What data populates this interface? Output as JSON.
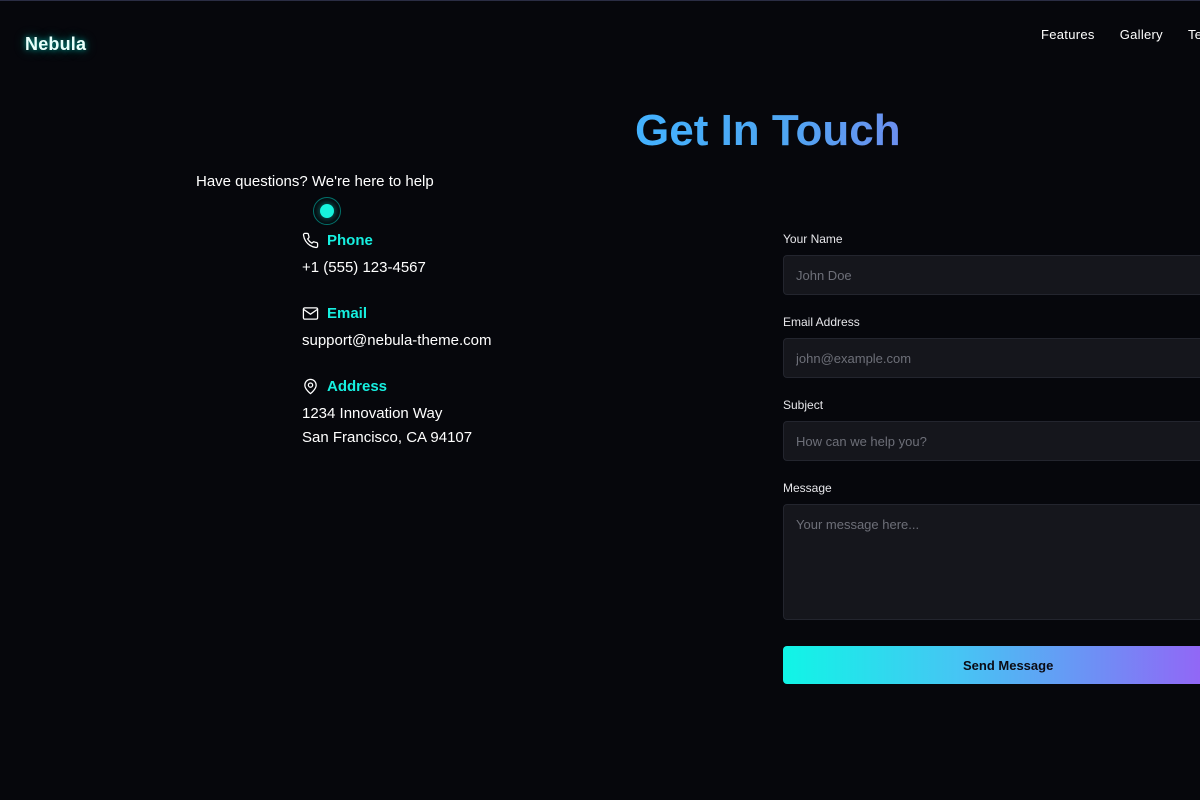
{
  "header": {
    "brand": "Nebula",
    "nav": [
      "Features",
      "Gallery",
      "Te"
    ]
  },
  "hero": {
    "title": "Get In Touch",
    "subtitle": "Have questions? We're here to help"
  },
  "contact": {
    "phone": {
      "label": "Phone",
      "value": "+1 (555) 123-4567",
      "icon": "phone-icon"
    },
    "email": {
      "label": "Email",
      "value": "support@nebula-theme.com",
      "icon": "mail-icon"
    },
    "address": {
      "label": "Address",
      "line1": "1234 Innovation Way",
      "line2": "San Francisco, CA 94107",
      "icon": "map-pin-icon"
    }
  },
  "form": {
    "name": {
      "label": "Your Name",
      "placeholder": "John Doe"
    },
    "email": {
      "label": "Email Address",
      "placeholder": "john@example.com"
    },
    "subject": {
      "label": "Subject",
      "placeholder": "How can we help you?"
    },
    "message": {
      "label": "Message",
      "placeholder": "Your message here..."
    },
    "submit": "Send Message"
  },
  "colors": {
    "background": "#06070c",
    "accent": "#16efe0",
    "title_gradient_start": "#43b2ff",
    "button_gradient_end": "#9b5cf6"
  }
}
